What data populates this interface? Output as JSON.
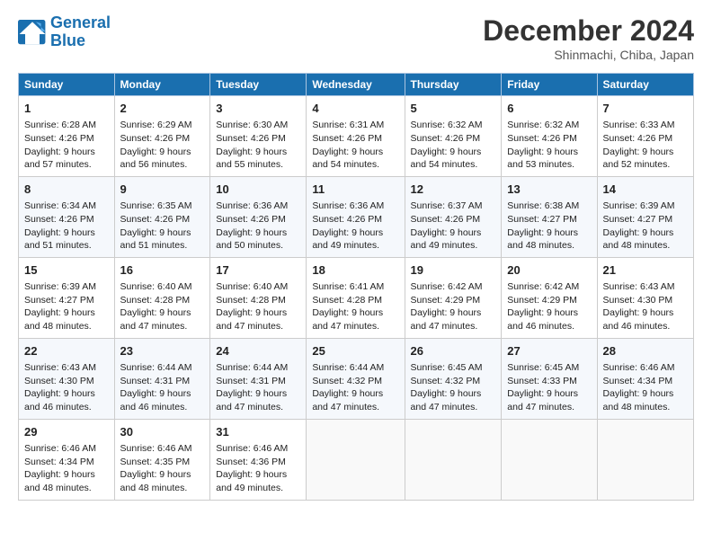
{
  "header": {
    "logo_line1": "General",
    "logo_line2": "Blue",
    "title": "December 2024",
    "subtitle": "Shinmachi, Chiba, Japan"
  },
  "days_of_week": [
    "Sunday",
    "Monday",
    "Tuesday",
    "Wednesday",
    "Thursday",
    "Friday",
    "Saturday"
  ],
  "weeks": [
    [
      {
        "day": "1",
        "info": "Sunrise: 6:28 AM\nSunset: 4:26 PM\nDaylight: 9 hours and 57 minutes."
      },
      {
        "day": "2",
        "info": "Sunrise: 6:29 AM\nSunset: 4:26 PM\nDaylight: 9 hours and 56 minutes."
      },
      {
        "day": "3",
        "info": "Sunrise: 6:30 AM\nSunset: 4:26 PM\nDaylight: 9 hours and 55 minutes."
      },
      {
        "day": "4",
        "info": "Sunrise: 6:31 AM\nSunset: 4:26 PM\nDaylight: 9 hours and 54 minutes."
      },
      {
        "day": "5",
        "info": "Sunrise: 6:32 AM\nSunset: 4:26 PM\nDaylight: 9 hours and 54 minutes."
      },
      {
        "day": "6",
        "info": "Sunrise: 6:32 AM\nSunset: 4:26 PM\nDaylight: 9 hours and 53 minutes."
      },
      {
        "day": "7",
        "info": "Sunrise: 6:33 AM\nSunset: 4:26 PM\nDaylight: 9 hours and 52 minutes."
      }
    ],
    [
      {
        "day": "8",
        "info": "Sunrise: 6:34 AM\nSunset: 4:26 PM\nDaylight: 9 hours and 51 minutes."
      },
      {
        "day": "9",
        "info": "Sunrise: 6:35 AM\nSunset: 4:26 PM\nDaylight: 9 hours and 51 minutes."
      },
      {
        "day": "10",
        "info": "Sunrise: 6:36 AM\nSunset: 4:26 PM\nDaylight: 9 hours and 50 minutes."
      },
      {
        "day": "11",
        "info": "Sunrise: 6:36 AM\nSunset: 4:26 PM\nDaylight: 9 hours and 49 minutes."
      },
      {
        "day": "12",
        "info": "Sunrise: 6:37 AM\nSunset: 4:26 PM\nDaylight: 9 hours and 49 minutes."
      },
      {
        "day": "13",
        "info": "Sunrise: 6:38 AM\nSunset: 4:27 PM\nDaylight: 9 hours and 48 minutes."
      },
      {
        "day": "14",
        "info": "Sunrise: 6:39 AM\nSunset: 4:27 PM\nDaylight: 9 hours and 48 minutes."
      }
    ],
    [
      {
        "day": "15",
        "info": "Sunrise: 6:39 AM\nSunset: 4:27 PM\nDaylight: 9 hours and 48 minutes."
      },
      {
        "day": "16",
        "info": "Sunrise: 6:40 AM\nSunset: 4:28 PM\nDaylight: 9 hours and 47 minutes."
      },
      {
        "day": "17",
        "info": "Sunrise: 6:40 AM\nSunset: 4:28 PM\nDaylight: 9 hours and 47 minutes."
      },
      {
        "day": "18",
        "info": "Sunrise: 6:41 AM\nSunset: 4:28 PM\nDaylight: 9 hours and 47 minutes."
      },
      {
        "day": "19",
        "info": "Sunrise: 6:42 AM\nSunset: 4:29 PM\nDaylight: 9 hours and 47 minutes."
      },
      {
        "day": "20",
        "info": "Sunrise: 6:42 AM\nSunset: 4:29 PM\nDaylight: 9 hours and 46 minutes."
      },
      {
        "day": "21",
        "info": "Sunrise: 6:43 AM\nSunset: 4:30 PM\nDaylight: 9 hours and 46 minutes."
      }
    ],
    [
      {
        "day": "22",
        "info": "Sunrise: 6:43 AM\nSunset: 4:30 PM\nDaylight: 9 hours and 46 minutes."
      },
      {
        "day": "23",
        "info": "Sunrise: 6:44 AM\nSunset: 4:31 PM\nDaylight: 9 hours and 46 minutes."
      },
      {
        "day": "24",
        "info": "Sunrise: 6:44 AM\nSunset: 4:31 PM\nDaylight: 9 hours and 47 minutes."
      },
      {
        "day": "25",
        "info": "Sunrise: 6:44 AM\nSunset: 4:32 PM\nDaylight: 9 hours and 47 minutes."
      },
      {
        "day": "26",
        "info": "Sunrise: 6:45 AM\nSunset: 4:32 PM\nDaylight: 9 hours and 47 minutes."
      },
      {
        "day": "27",
        "info": "Sunrise: 6:45 AM\nSunset: 4:33 PM\nDaylight: 9 hours and 47 minutes."
      },
      {
        "day": "28",
        "info": "Sunrise: 6:46 AM\nSunset: 4:34 PM\nDaylight: 9 hours and 48 minutes."
      }
    ],
    [
      {
        "day": "29",
        "info": "Sunrise: 6:46 AM\nSunset: 4:34 PM\nDaylight: 9 hours and 48 minutes."
      },
      {
        "day": "30",
        "info": "Sunrise: 6:46 AM\nSunset: 4:35 PM\nDaylight: 9 hours and 48 minutes."
      },
      {
        "day": "31",
        "info": "Sunrise: 6:46 AM\nSunset: 4:36 PM\nDaylight: 9 hours and 49 minutes."
      },
      {
        "day": "",
        "info": ""
      },
      {
        "day": "",
        "info": ""
      },
      {
        "day": "",
        "info": ""
      },
      {
        "day": "",
        "info": ""
      }
    ]
  ]
}
